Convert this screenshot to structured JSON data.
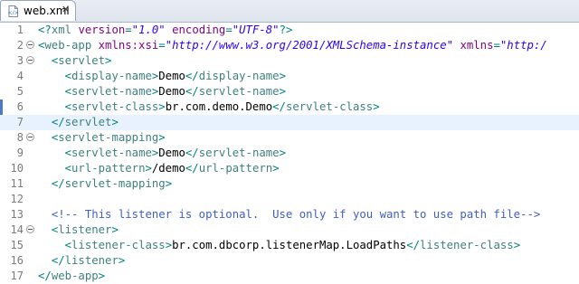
{
  "tab": {
    "title": "web.xml",
    "close_label": "✕",
    "icon": "xml-file-icon"
  },
  "editor": {
    "lines": [
      {
        "num": "1",
        "fold": false,
        "html": "<span class='p'>&lt;?</span><span class='t'>xml</span> <span class='a'>version</span>=<span class='v'>\"1.0\"</span> <span class='a'>encoding</span>=<span class='v'>\"UTF-8\"</span><span class='p'>?&gt;</span>"
      },
      {
        "num": "2",
        "fold": true,
        "html": "<span class='p'>&lt;</span><span class='t'>web-app</span> <span class='a'>xmlns:xsi</span>=<span class='v'>\"http://www.w3.org/2001/XMLSchema-instance\"</span> <span class='a'>xmlns</span>=<span class='v'>\"http:/</span>"
      },
      {
        "num": "3",
        "fold": true,
        "html": "  <span class='p'>&lt;</span><span class='t'>servlet</span><span class='p'>&gt;</span>"
      },
      {
        "num": "4",
        "fold": false,
        "html": "    <span class='p'>&lt;</span><span class='t'>display-name</span><span class='p'>&gt;</span><span class='x'>Demo</span><span class='p'>&lt;/</span><span class='t'>display-name</span><span class='p'>&gt;</span>"
      },
      {
        "num": "5",
        "fold": false,
        "html": "    <span class='p'>&lt;</span><span class='t'>servlet-name</span><span class='p'>&gt;</span><span class='x'>Demo</span><span class='p'>&lt;/</span><span class='t'>servlet-name</span><span class='p'>&gt;</span>"
      },
      {
        "num": "6",
        "fold": false,
        "change": true,
        "html": "    <span class='p'>&lt;</span><span class='t'>servlet-class</span><span class='p'>&gt;</span><span class='x'>br.com.demo.Demo</span><span class='p'>&lt;/</span><span class='t'>servlet-class</span><span class='p'>&gt;</span>"
      },
      {
        "num": "7",
        "fold": false,
        "current": true,
        "html": "  <span class='p'>&lt;/</span><span class='t'>servlet</span><span class='p'>&gt;</span>"
      },
      {
        "num": "8",
        "fold": true,
        "html": "  <span class='p'>&lt;</span><span class='t'>servlet-mapping</span><span class='p'>&gt;</span>"
      },
      {
        "num": "9",
        "fold": false,
        "html": "    <span class='p'>&lt;</span><span class='t'>servlet-name</span><span class='p'>&gt;</span><span class='x'>Demo</span><span class='p'>&lt;/</span><span class='t'>servlet-name</span><span class='p'>&gt;</span>"
      },
      {
        "num": "10",
        "fold": false,
        "html": "    <span class='p'>&lt;</span><span class='t'>url-pattern</span><span class='p'>&gt;</span><span class='x'>/demo</span><span class='p'>&lt;/</span><span class='t'>url-pattern</span><span class='p'>&gt;</span>"
      },
      {
        "num": "11",
        "fold": false,
        "html": "  <span class='p'>&lt;/</span><span class='t'>servlet-mapping</span><span class='p'>&gt;</span>"
      },
      {
        "num": "12",
        "fold": false,
        "html": ""
      },
      {
        "num": "13",
        "fold": false,
        "html": "  <span class='c'>&lt;!-- This listener is optional.  Use only if you want to use path file--&gt;</span>"
      },
      {
        "num": "14",
        "fold": true,
        "html": "  <span class='p'>&lt;</span><span class='t'>listener</span><span class='p'>&gt;</span>"
      },
      {
        "num": "15",
        "fold": false,
        "html": "    <span class='p'>&lt;</span><span class='t'>listener-class</span><span class='p'>&gt;</span><span class='x'>br.com.dbcorp.listenerMap.LoadPaths</span><span class='p'>&lt;/</span><span class='t'>listener-class</span><span class='p'>&gt;</span>"
      },
      {
        "num": "16",
        "fold": false,
        "html": "  <span class='p'>&lt;/</span><span class='t'>listener</span><span class='p'>&gt;</span>"
      },
      {
        "num": "17",
        "fold": false,
        "html": "<span class='p'>&lt;/</span><span class='t'>web-app</span><span class='p'>&gt;</span>"
      }
    ]
  }
}
